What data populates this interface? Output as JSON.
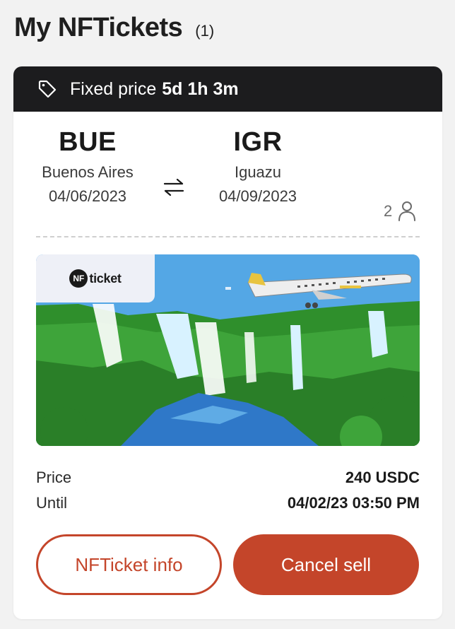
{
  "page": {
    "title": "My NFTickets",
    "count": "(1)"
  },
  "listing": {
    "banner": {
      "icon": "tag-icon",
      "label": "Fixed price",
      "time_left": "5d 1h 3m"
    },
    "origin": {
      "code": "BUE",
      "city": "Buenos Aires",
      "date": "04/06/2023"
    },
    "destination": {
      "code": "IGR",
      "city": "Iguazu",
      "date": "04/09/2023"
    },
    "swap_icon": "swap-arrows-icon",
    "passengers": {
      "count": "2",
      "icon": "person-icon"
    },
    "artwork": {
      "logo_text": "ticket",
      "logo_mark": "NF"
    },
    "details": [
      {
        "label": "Price",
        "value": "240 USDC"
      },
      {
        "label": "Until",
        "value": "04/02/23 03:50 PM"
      }
    ],
    "buttons": {
      "info": "NFTicket info",
      "cancel": "Cancel sell"
    }
  },
  "colors": {
    "accent": "#c4452a",
    "banner_bg": "#1c1c1e",
    "sky": "#54a7e5"
  }
}
